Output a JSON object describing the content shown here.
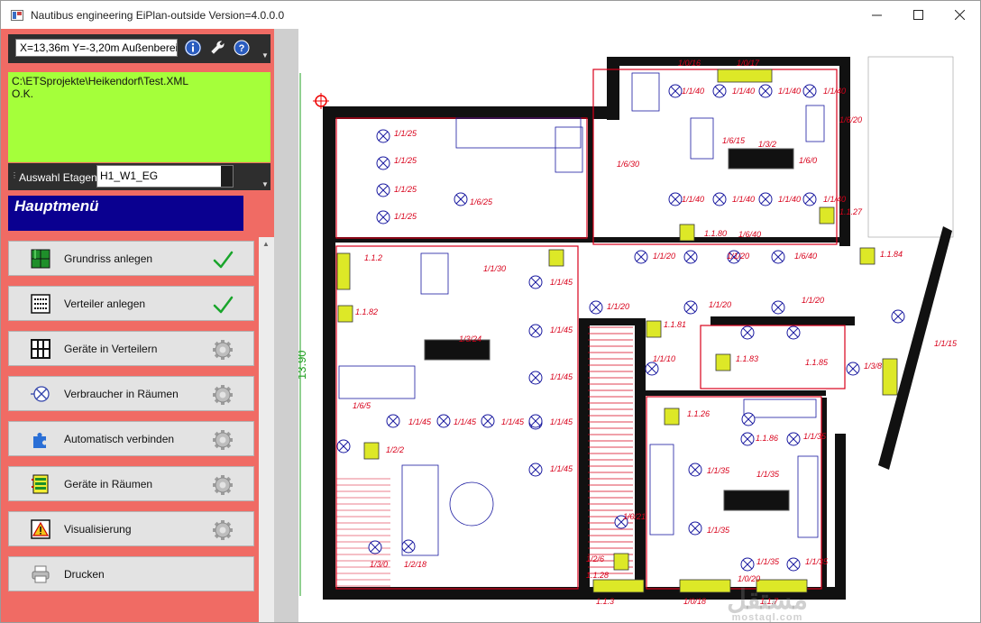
{
  "window": {
    "title": "Nautibus engineering EiPlan-outside  Version=4.0.0.0"
  },
  "toolbar": {
    "coordinates": "X=13,36m Y=-3,20m  Außenbereich",
    "info_icon": "info-icon",
    "tools_icon": "wrench-icon",
    "help_icon": "help-icon"
  },
  "status": {
    "path": "C:\\ETSprojekte\\Heikendorf\\Test.XML",
    "message": "O.K."
  },
  "floors": {
    "label": "Auswahl Etagen",
    "selected": "H1_W1_EG"
  },
  "menu": {
    "title": "Hauptmenü",
    "items": [
      {
        "label": "Grundriss anlegen",
        "icon": "floorplan-icon",
        "done": true
      },
      {
        "label": "Verteiler anlegen",
        "icon": "distributor-icon",
        "done": true
      },
      {
        "label": "Geräte in Verteilern",
        "icon": "devices-grid-icon",
        "done": false
      },
      {
        "label": "Verbraucher in Räumen",
        "icon": "lamp-icon",
        "done": false
      },
      {
        "label": "Automatisch verbinden",
        "icon": "puzzle-icon",
        "done": false
      },
      {
        "label": "Geräte in Räumen",
        "icon": "room-devices-icon",
        "done": false
      },
      {
        "label": "Visualisierung",
        "icon": "warning-icon",
        "done": false
      },
      {
        "label": "Drucken",
        "icon": "printer-icon",
        "done": false
      }
    ]
  },
  "plan": {
    "dimension": "13.90",
    "lamp_labels": [
      {
        "text": "1/1/25"
      },
      {
        "text": "1/1/25"
      },
      {
        "text": "1/1/25"
      },
      {
        "text": "1/1/25"
      },
      {
        "text": "1/6/25"
      },
      {
        "text": "1/6/30"
      },
      {
        "text": "1/6/15"
      },
      {
        "text": "1/3/2"
      },
      {
        "text": "1/6/0"
      },
      {
        "text": "1/1/40"
      },
      {
        "text": "1/1/40"
      },
      {
        "text": "1/1/40"
      },
      {
        "text": "1/1/40"
      },
      {
        "text": "1/1/40"
      },
      {
        "text": "1/1/40"
      },
      {
        "text": "1/1/40"
      },
      {
        "text": "1/1/40"
      },
      {
        "text": "1/0/16"
      },
      {
        "text": "1/0/17"
      },
      {
        "text": "1/6/20"
      },
      {
        "text": "1.1.27"
      },
      {
        "text": "1.1.80"
      },
      {
        "text": "1/6/40"
      },
      {
        "text": "1.1.2"
      },
      {
        "text": "1.1.82"
      },
      {
        "text": "1/1/20"
      },
      {
        "text": "1/1/20"
      },
      {
        "text": "1/6/40"
      },
      {
        "text": "1.1.84"
      },
      {
        "text": "1/1/20"
      },
      {
        "text": "1/1/20"
      },
      {
        "text": "1/1/20"
      },
      {
        "text": "1/1/30"
      },
      {
        "text": "1/1/45"
      },
      {
        "text": "1/1/45"
      },
      {
        "text": "1/1/45"
      },
      {
        "text": "1/1/45"
      },
      {
        "text": "1/1/45"
      },
      {
        "text": "1/1/45"
      },
      {
        "text": "1/1/45"
      },
      {
        "text": "1/1/45"
      },
      {
        "text": "1/3/24"
      },
      {
        "text": "1.1.81"
      },
      {
        "text": "1.1.83"
      },
      {
        "text": "1.1.85"
      },
      {
        "text": "1/3/8"
      },
      {
        "text": "1/1/15"
      },
      {
        "text": "1/6/5"
      },
      {
        "text": "1/2/2"
      },
      {
        "text": "1.1.26"
      },
      {
        "text": "1.1.86"
      },
      {
        "text": "1/1/35"
      },
      {
        "text": "1/1/35"
      },
      {
        "text": "1/1/35"
      },
      {
        "text": "1/1/35"
      },
      {
        "text": "1/1/35"
      },
      {
        "text": "1/1/35"
      },
      {
        "text": "1/3/0"
      },
      {
        "text": "1/2/18"
      },
      {
        "text": "1/2/6"
      },
      {
        "text": "1.1.28"
      },
      {
        "text": "1.1.3"
      },
      {
        "text": "1/0/18"
      },
      {
        "text": "1/0/20"
      },
      {
        "text": "1.1.7"
      },
      {
        "text": "1/0/21"
      },
      {
        "text": "1/1/10"
      },
      {
        "text": "1/1/20"
      }
    ]
  },
  "watermark": {
    "line1": "مستقل",
    "line2": "mostaql.com"
  },
  "colors": {
    "panel": "#f06b64",
    "status_ok": "#a5ff3a",
    "menu_title": "#0a0090",
    "plan_red": "#d8001a",
    "plan_blue": "#1a1aa0",
    "plan_dim": "#22a022"
  }
}
